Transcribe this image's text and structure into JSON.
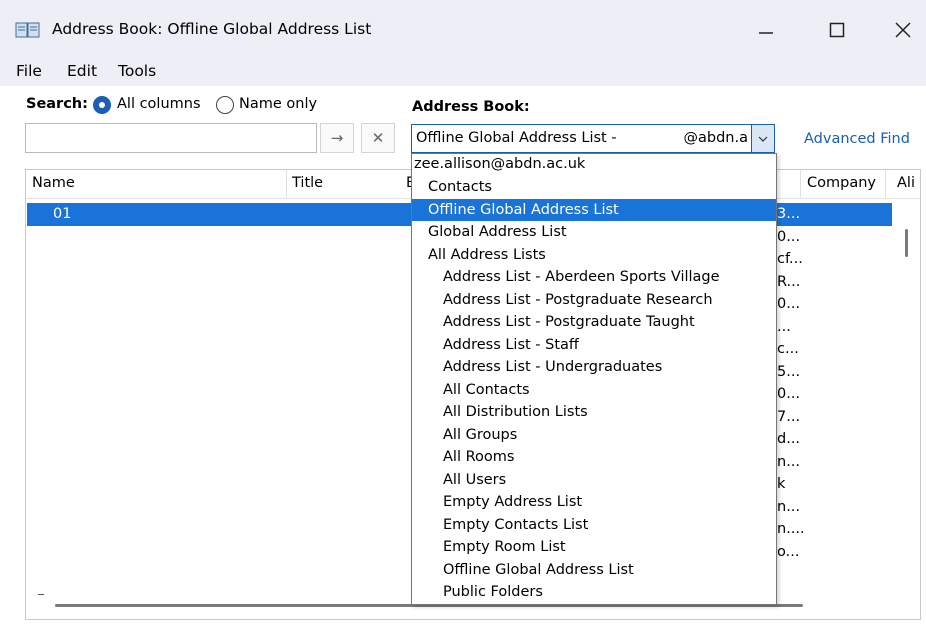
{
  "window": {
    "title": "Address Book: Offline Global Address List",
    "icon": "address-book-icon",
    "minimize_glyph": "—",
    "close_glyph": "✕"
  },
  "menu": [
    "File",
    "Edit",
    "Tools"
  ],
  "search": {
    "label": "Search:",
    "option_all": "All columns",
    "option_name": "Name only",
    "selected": "All columns",
    "value": "",
    "go_glyph": "→",
    "clear_glyph": "✕"
  },
  "address_book": {
    "label": "Address Book:",
    "selected_text": "Offline Global Address List -",
    "selected_domain": "@abdn.a",
    "advanced_find": "Advanced Find"
  },
  "columns": {
    "name": "Name",
    "title": "Title",
    "partial": "E",
    "company": "Company",
    "alias": "Ali"
  },
  "rows": {
    "selected_name": "01"
  },
  "right_cells": [
    "3...",
    "0...",
    "cf...",
    "R...",
    "0...",
    "...",
    "c...",
    "5...",
    "0...",
    "7...",
    "d...",
    "n...",
    "k",
    "n...",
    "n....",
    "o..."
  ],
  "dropdown": {
    "account": "zee.allison@abdn.ac.uk",
    "items": [
      {
        "label": "Contacts",
        "indent": 1,
        "selected": false
      },
      {
        "label": "Offline Global Address List",
        "indent": 1,
        "selected": true
      },
      {
        "label": "Global Address List",
        "indent": 1,
        "selected": false
      },
      {
        "label": "All Address Lists",
        "indent": 1,
        "selected": false
      },
      {
        "label": "Address List - Aberdeen Sports Village",
        "indent": 2,
        "selected": false
      },
      {
        "label": "Address List - Postgraduate Research",
        "indent": 2,
        "selected": false
      },
      {
        "label": "Address List - Postgraduate Taught",
        "indent": 2,
        "selected": false
      },
      {
        "label": "Address List - Staff",
        "indent": 2,
        "selected": false
      },
      {
        "label": "Address List - Undergraduates",
        "indent": 2,
        "selected": false
      },
      {
        "label": "All Contacts",
        "indent": 2,
        "selected": false
      },
      {
        "label": "All Distribution Lists",
        "indent": 2,
        "selected": false
      },
      {
        "label": "All Groups",
        "indent": 2,
        "selected": false
      },
      {
        "label": "All Rooms",
        "indent": 2,
        "selected": false
      },
      {
        "label": "All Users",
        "indent": 2,
        "selected": false
      },
      {
        "label": "Empty Address List",
        "indent": 2,
        "selected": false
      },
      {
        "label": "Empty Contacts List",
        "indent": 2,
        "selected": false
      },
      {
        "label": "Empty Room List",
        "indent": 2,
        "selected": false
      },
      {
        "label": "Offline Global Address List",
        "indent": 2,
        "selected": false
      },
      {
        "label": "Public Folders",
        "indent": 2,
        "selected": false
      }
    ]
  },
  "colors": {
    "accent": "#1a5fb4",
    "selection": "#1a73d8",
    "titlebar": "#eeeef7"
  }
}
